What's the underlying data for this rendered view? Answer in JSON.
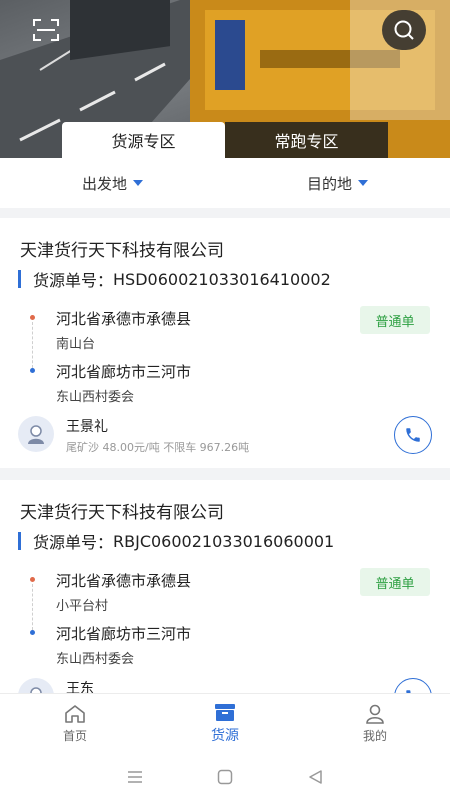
{
  "tabs": {
    "source": "货源专区",
    "regular": "常跑专区"
  },
  "filters": {
    "origin": "出发地",
    "destination": "目的地"
  },
  "cards": [
    {
      "company": "天津货行天下科技有限公司",
      "order_label": "货源单号：",
      "order_no": "HSD060021033016410002",
      "from_main": "河北省承德市承德县",
      "from_sub": "南山台",
      "to_main": "河北省廊坊市三河市",
      "to_sub": "东山西村委会",
      "badge": "普通单",
      "driver": "王景礼",
      "goods": "尾矿沙 48.00元/吨 不限车 967.26吨"
    },
    {
      "company": "天津货行天下科技有限公司",
      "order_label": "货源单号：",
      "order_no": "RBJC060021033016060001",
      "from_main": "河北省承德市承德县",
      "from_sub": "小平台村",
      "to_main": "河北省廊坊市三河市",
      "to_sub": "东山西村委会",
      "badge": "普通单",
      "driver": "王东",
      "goods": ""
    }
  ],
  "nav": {
    "home": "首页",
    "source": "货源",
    "mine": "我的"
  },
  "colors": {
    "accent": "#2f6fd6",
    "badge_bg": "#e8f6ea",
    "badge_text": "#2ea043",
    "origin_dot": "#e06a4a"
  }
}
